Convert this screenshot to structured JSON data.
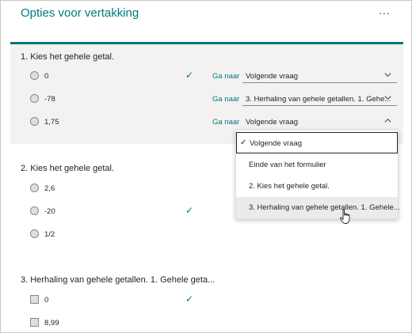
{
  "header": {
    "title": "Opties voor vertakking",
    "more_label": "..."
  },
  "goto_label": "Ga naar",
  "questions": [
    {
      "title": "1. Kies het gehele getal.",
      "options": [
        {
          "label": "0",
          "correct": true,
          "goto": "Volgende vraag"
        },
        {
          "label": "-78",
          "correct": false,
          "goto": "3. Herhaling van gehele getallen. 1. Gehe..."
        },
        {
          "label": "1,75",
          "correct": false,
          "goto": "Volgende vraag"
        }
      ]
    },
    {
      "title": "2. Kies het gehele getal.",
      "options": [
        {
          "label": "2,6",
          "correct": false
        },
        {
          "label": "-20",
          "correct": true
        },
        {
          "label": "1/2",
          "correct": false
        }
      ]
    },
    {
      "title": "3. Herhaling van gehele getallen. 1. Gehele geta...",
      "options": [
        {
          "label": "0",
          "correct": true
        },
        {
          "label": "8,99",
          "correct": false
        }
      ]
    }
  ],
  "dropdown_menu": {
    "items": [
      {
        "label": "Volgende vraag",
        "selected": true
      },
      {
        "label": "Einde van het formulier",
        "selected": false
      },
      {
        "label": "2. Kies het gehele getal.",
        "selected": false
      },
      {
        "label": "3. Herhaling van gehele getallen. 1. Gehele...",
        "selected": false,
        "hovered": true
      }
    ]
  },
  "colors": {
    "accent": "#03787c",
    "selected_band": "#f3f2f1",
    "hover": "#edebe9"
  },
  "icons": {
    "check": "check-icon",
    "chevron_down": "chevron-down-icon",
    "chevron_up": "chevron-up-icon",
    "more": "more-icon",
    "pointer": "hand-pointer-icon"
  }
}
